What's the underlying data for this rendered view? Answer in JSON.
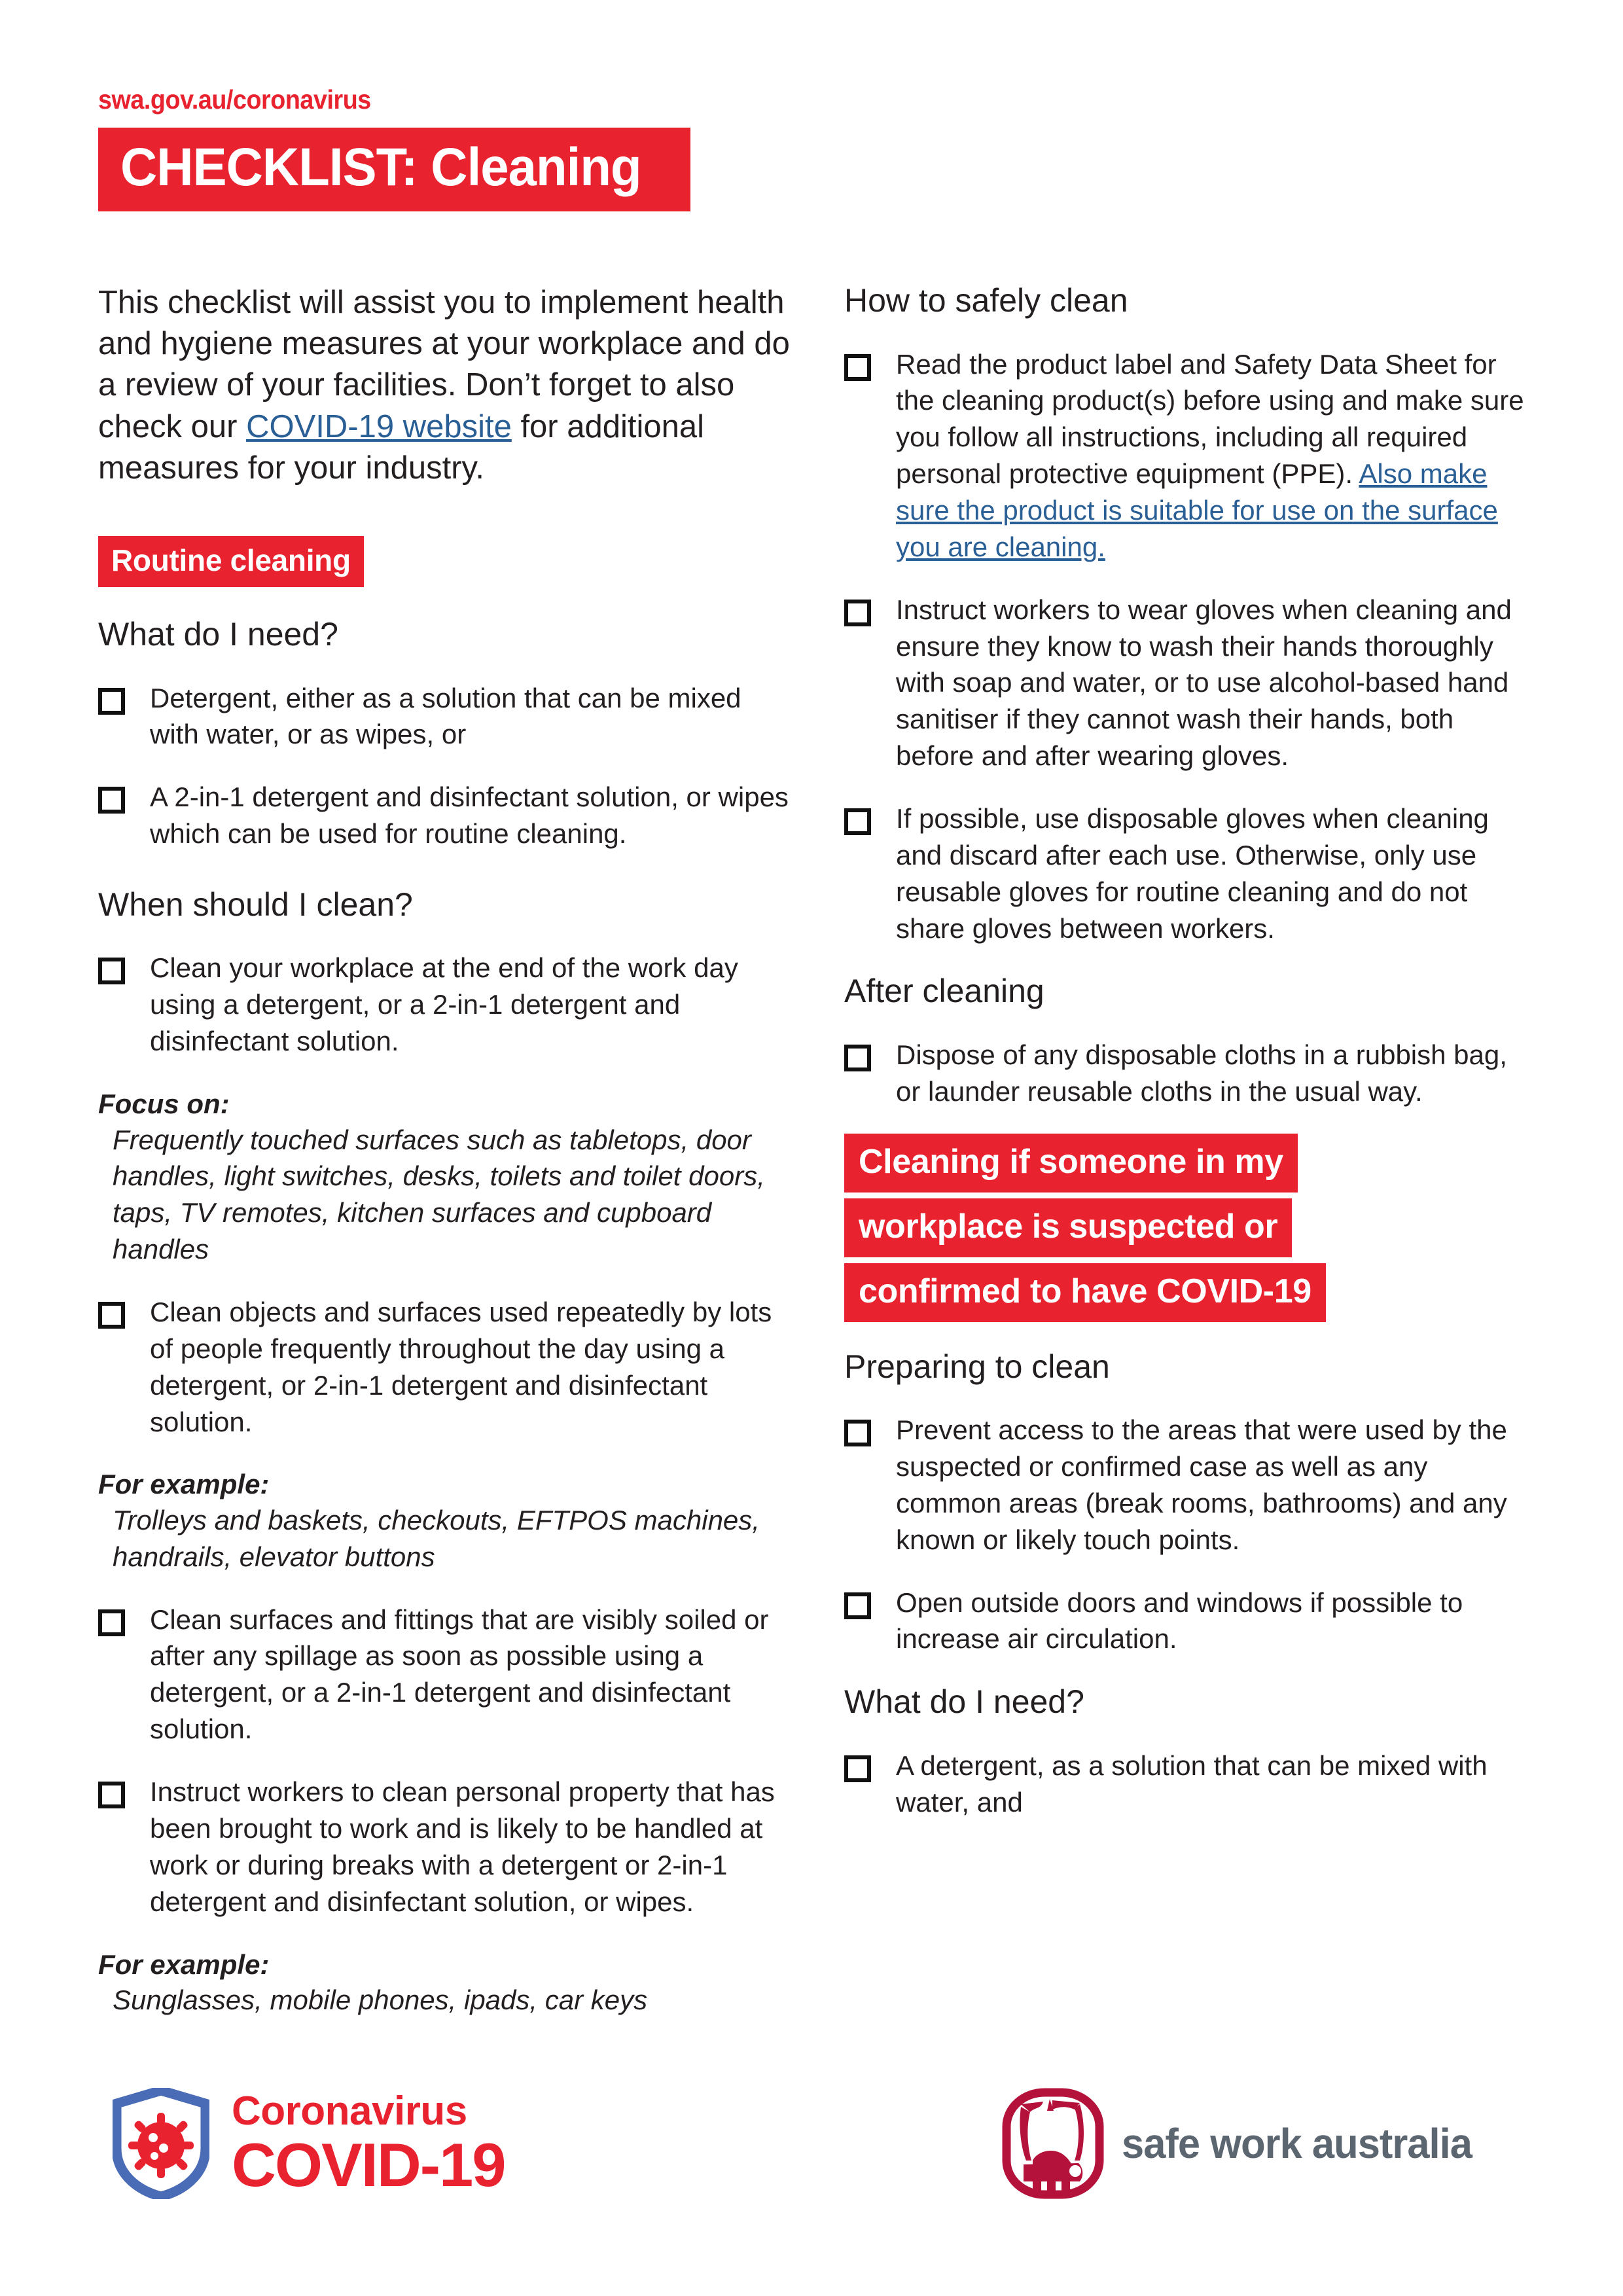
{
  "header": {
    "site_url": "swa.gov.au/coronavirus",
    "title": "CHECKLIST: Cleaning"
  },
  "colors": {
    "brand_red": "#E8222F",
    "link_blue": "#2A5F96",
    "text": "#231f20",
    "swa_grey": "#5B6670",
    "shield_blue": "#4A6BB5"
  },
  "intro": {
    "text_before_link": "This checklist will assist you to implement health and hygiene measures at your workplace and do a review of your facilities. Don’t forget to also check our ",
    "link_text": "COVID-19 website",
    "text_after_link": " for additional measures for your industry."
  },
  "left_column": {
    "red_label": "Routine cleaning",
    "section_what_do_i_need": {
      "heading": "What do I need?",
      "items": [
        "Detergent, either as a solution that can be mixed with water, or as wipes, or",
        "A 2-in-1 detergent and disinfectant solution, or wipes which can be used for routine cleaning."
      ]
    },
    "section_when_should_i_clean": {
      "heading": "When should I clean?",
      "item1": "Clean your workplace at the end of the work day using a detergent, or a 2-in-1 detergent and disinfectant solution.",
      "note1_title": "Focus on:",
      "note1_body": "Frequently touched surfaces such as tabletops, door handles, light switches, desks, toilets and toilet doors, taps, TV remotes, kitchen surfaces and cupboard handles",
      "item2": "Clean objects and surfaces used repeatedly by lots of people frequently throughout the day using a detergent, or 2-in-1 detergent and disinfectant solution.",
      "note2_title": "For example:",
      "note2_body": "Trolleys and baskets, checkouts, EFTPOS machines, handrails, elevator buttons",
      "item3": "Clean surfaces and fittings that are visibly soiled or after any spillage as soon as possible using a detergent, or a 2-in-1 detergent and disinfectant solution.",
      "item4": "Instruct workers to clean personal property that has been brought to work and is likely to be handled at work or during breaks with a detergent or 2-in-1 detergent and disinfectant solution, or wipes.",
      "note3_title": "For example:",
      "note3_body": "Sunglasses, mobile phones, ipads, car keys"
    }
  },
  "right_column": {
    "section_how_to_safely_clean": {
      "heading": "How to safely clean",
      "item1_before_link": "Read the product label and Safety Data Sheet for the cleaning product(s) before using and make sure you follow all instructions, including all required personal protective equipment (PPE). ",
      "item1_link": "Also make sure the product is suitable for use on the surface you are cleaning.",
      "item2": "Instruct workers to wear gloves when cleaning and ensure they know to wash their hands thoroughly with soap and water, or to use alcohol-based hand sanitiser if they cannot wash their hands, both before and after wearing gloves.",
      "item3": "If possible, use disposable gloves when cleaning and discard after each use. Otherwise, only use reusable gloves for routine cleaning and do not share gloves between workers."
    },
    "section_after_cleaning": {
      "heading": "After cleaning",
      "item1": "Dispose of any disposable cloths in a rubbish bag, or launder reusable cloths in the usual way."
    },
    "red_banner_lines": [
      "Cleaning if someone in my",
      "workplace is suspected or",
      "confirmed to have COVID-19"
    ],
    "section_preparing_to_clean": {
      "heading": "Preparing to clean",
      "item1": "Prevent access to the areas that were used by the suspected or confirmed case as well as any common areas (break rooms, bathrooms) and any known or likely touch points.",
      "item2": "Open outside doors and windows if possible to increase air circulation."
    },
    "section_what_do_i_need": {
      "heading": "What do I need?",
      "item1": "A detergent, as a solution that can be mixed with water, and"
    }
  },
  "footer": {
    "covid_logo_line1": "Coronavirus",
    "covid_logo_line2": "COVID-19",
    "swa_logo_text": "safe work australia"
  }
}
